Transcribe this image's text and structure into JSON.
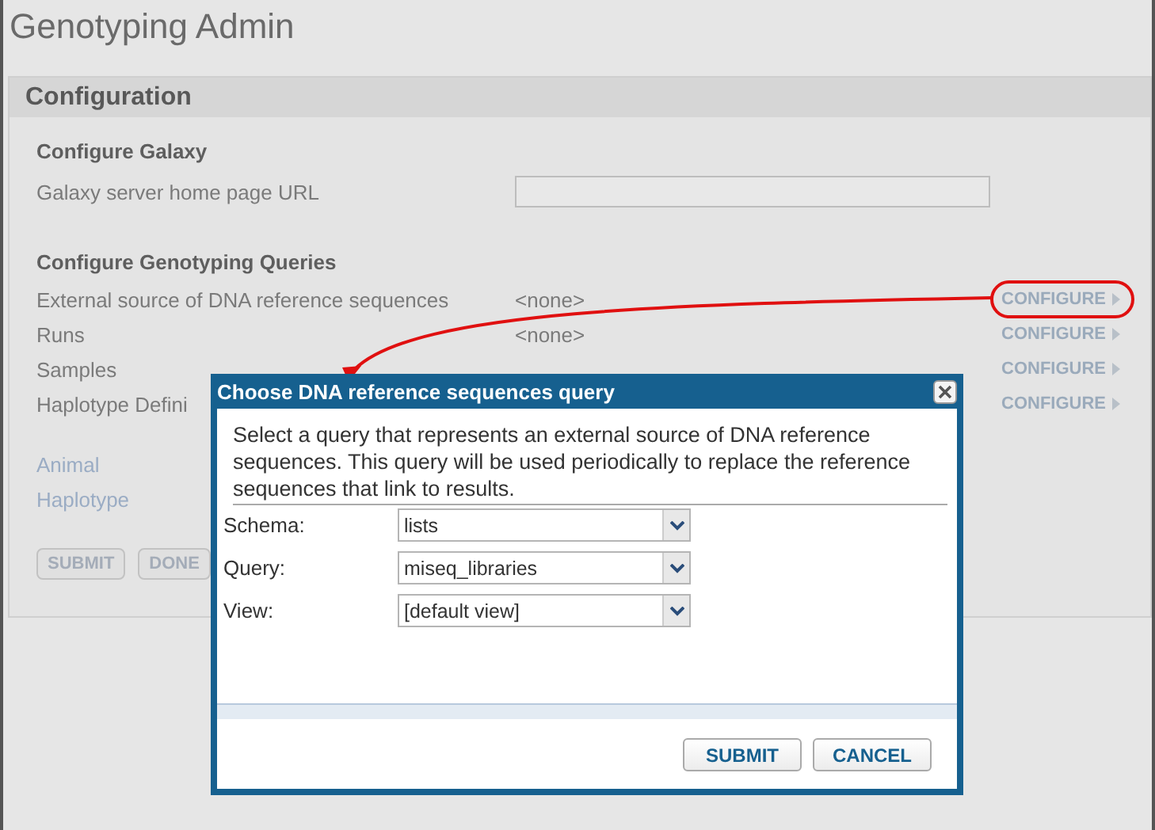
{
  "page_title": "Genotyping Admin",
  "panel": {
    "title": "Configuration",
    "galaxy": {
      "heading": "Configure Galaxy",
      "label": "Galaxy server home page URL"
    },
    "queries": {
      "heading": "Configure Genotyping Queries",
      "rows": [
        {
          "label": "External source of DNA reference sequences",
          "value": "<none>",
          "link": "CONFIGURE"
        },
        {
          "label": "Runs",
          "value": "<none>",
          "link": "CONFIGURE"
        },
        {
          "label": "Samples",
          "link": "CONFIGURE"
        },
        {
          "label": "Haplotype Defini",
          "link": "CONFIGURE"
        }
      ]
    },
    "links": [
      "Animal",
      "Haplotype"
    ],
    "buttons": [
      "SUBMIT",
      "DONE"
    ]
  },
  "dialog": {
    "title": "Choose DNA reference sequences query",
    "description": "Select a query that represents an external source of DNA reference sequences. This query will be used periodically to replace the reference sequences that link to results.",
    "fields": [
      {
        "label": "Schema:",
        "value": "lists"
      },
      {
        "label": "Query:",
        "value": "miseq_libraries"
      },
      {
        "label": "View:",
        "value": "[default view]"
      }
    ],
    "buttons": [
      "SUBMIT",
      "CANCEL"
    ]
  }
}
